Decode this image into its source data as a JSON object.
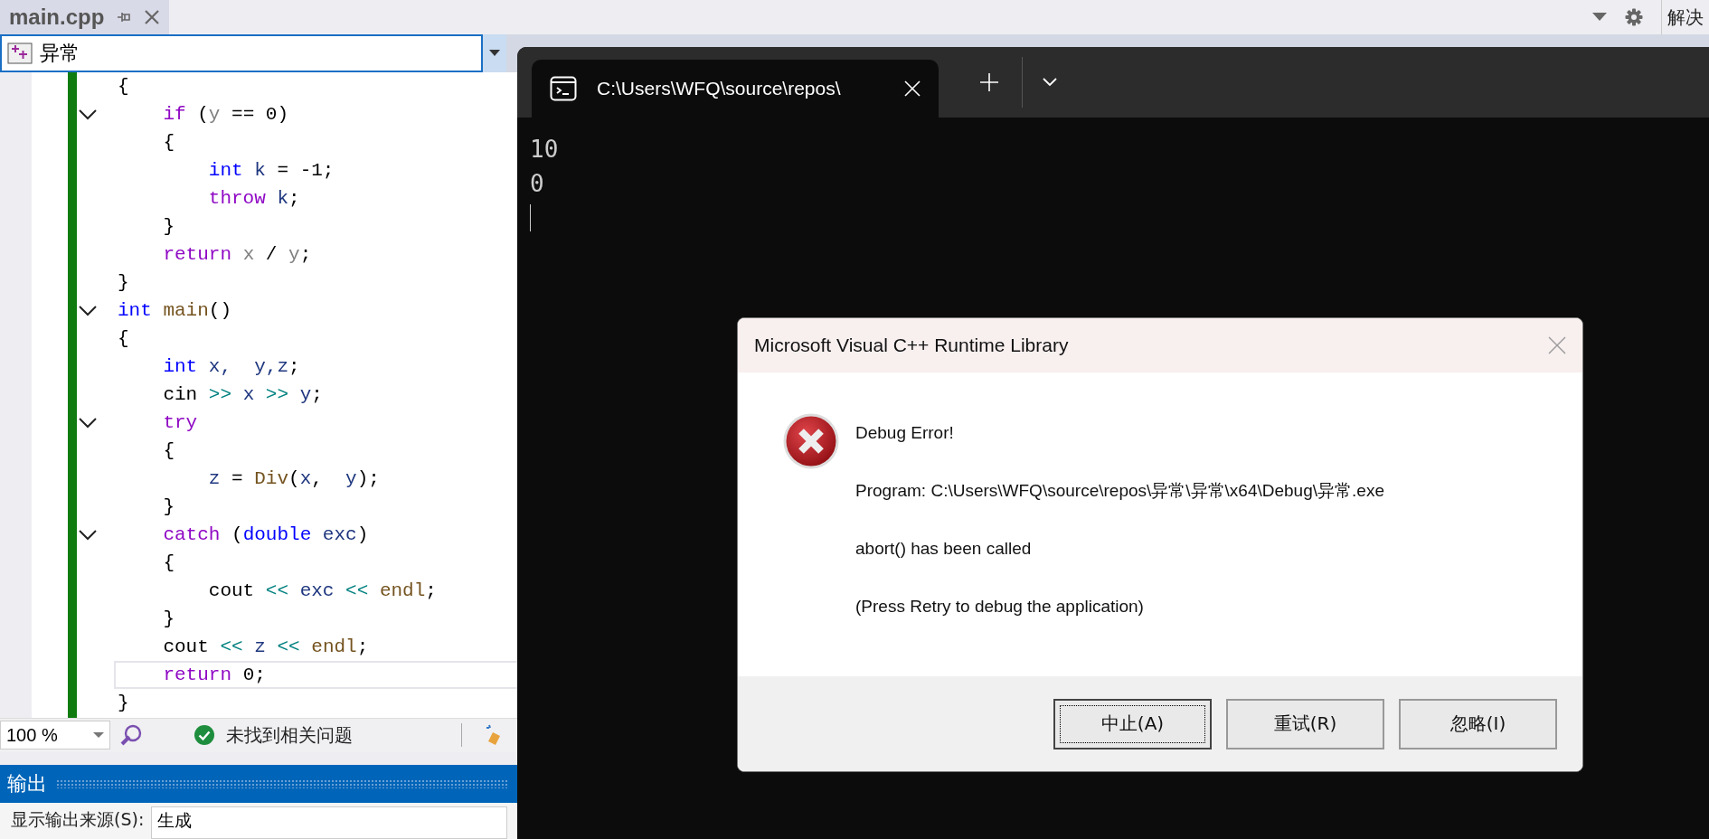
{
  "ide": {
    "doc_tab": {
      "title": "main.cpp",
      "selected": true
    },
    "nav": {
      "value": "异常"
    },
    "side_title": "解决",
    "code_lines": [
      {
        "fold": false,
        "current": false,
        "tokens": [
          {
            "text": "{",
            "kind": "plain"
          }
        ]
      },
      {
        "fold": true,
        "current": false,
        "tokens": [
          {
            "text": "    if",
            "kind": "keyword"
          },
          {
            "text": " (",
            "kind": "plain"
          },
          {
            "text": "y",
            "kind": "param"
          },
          {
            "text": " == 0)",
            "kind": "plain"
          }
        ]
      },
      {
        "fold": false,
        "current": false,
        "tokens": [
          {
            "text": "    {",
            "kind": "plain"
          }
        ]
      },
      {
        "fold": false,
        "current": false,
        "tokens": [
          {
            "text": "        int",
            "kind": "type"
          },
          {
            "text": " k",
            "kind": "local"
          },
          {
            "text": " = -1;",
            "kind": "plain"
          }
        ]
      },
      {
        "fold": false,
        "current": false,
        "tokens": [
          {
            "text": "        throw",
            "kind": "keyword"
          },
          {
            "text": " k",
            "kind": "local"
          },
          {
            "text": ";",
            "kind": "plain"
          }
        ]
      },
      {
        "fold": false,
        "current": false,
        "tokens": [
          {
            "text": "    }",
            "kind": "plain"
          }
        ]
      },
      {
        "fold": false,
        "current": false,
        "tokens": [
          {
            "text": "    return",
            "kind": "keyword"
          },
          {
            "text": " x",
            "kind": "param"
          },
          {
            "text": " / ",
            "kind": "plain"
          },
          {
            "text": "y",
            "kind": "param"
          },
          {
            "text": ";",
            "kind": "plain"
          }
        ]
      },
      {
        "fold": false,
        "current": false,
        "tokens": [
          {
            "text": "}",
            "kind": "plain"
          }
        ]
      },
      {
        "fold": true,
        "current": false,
        "tokens": [
          {
            "text": "int",
            "kind": "type"
          },
          {
            "text": " main",
            "kind": "func"
          },
          {
            "text": "()",
            "kind": "plain"
          }
        ]
      },
      {
        "fold": false,
        "current": false,
        "tokens": [
          {
            "text": "{",
            "kind": "plain"
          }
        ]
      },
      {
        "fold": false,
        "current": false,
        "tokens": [
          {
            "text": "    int",
            "kind": "type"
          },
          {
            "text": " x,  y,z",
            "kind": "local"
          },
          {
            "text": ";",
            "kind": "plain"
          }
        ]
      },
      {
        "fold": false,
        "current": false,
        "tokens": [
          {
            "text": "    cin",
            "kind": "plain"
          },
          {
            "text": " >>",
            "kind": "op"
          },
          {
            "text": " x",
            "kind": "local"
          },
          {
            "text": " >>",
            "kind": "op"
          },
          {
            "text": " y",
            "kind": "local"
          },
          {
            "text": ";",
            "kind": "plain"
          }
        ]
      },
      {
        "fold": true,
        "current": false,
        "tokens": [
          {
            "text": "    try",
            "kind": "keyword"
          }
        ]
      },
      {
        "fold": false,
        "current": false,
        "tokens": [
          {
            "text": "    {",
            "kind": "plain"
          }
        ]
      },
      {
        "fold": false,
        "current": false,
        "tokens": [
          {
            "text": "        z",
            "kind": "local"
          },
          {
            "text": " = ",
            "kind": "plain"
          },
          {
            "text": "Div",
            "kind": "func"
          },
          {
            "text": "(",
            "kind": "plain"
          },
          {
            "text": "x",
            "kind": "local"
          },
          {
            "text": ",  ",
            "kind": "plain"
          },
          {
            "text": "y",
            "kind": "local"
          },
          {
            "text": ");",
            "kind": "plain"
          }
        ]
      },
      {
        "fold": false,
        "current": false,
        "tokens": [
          {
            "text": "    }",
            "kind": "plain"
          }
        ]
      },
      {
        "fold": true,
        "current": false,
        "tokens": [
          {
            "text": "    catch",
            "kind": "keyword"
          },
          {
            "text": " (",
            "kind": "plain"
          },
          {
            "text": "double",
            "kind": "type"
          },
          {
            "text": " exc",
            "kind": "local"
          },
          {
            "text": ")",
            "kind": "plain"
          }
        ]
      },
      {
        "fold": false,
        "current": false,
        "tokens": [
          {
            "text": "    {",
            "kind": "plain"
          }
        ]
      },
      {
        "fold": false,
        "current": false,
        "tokens": [
          {
            "text": "        cout",
            "kind": "plain"
          },
          {
            "text": " <<",
            "kind": "op"
          },
          {
            "text": " exc",
            "kind": "local"
          },
          {
            "text": " <<",
            "kind": "op"
          },
          {
            "text": " endl",
            "kind": "func"
          },
          {
            "text": ";",
            "kind": "plain"
          }
        ]
      },
      {
        "fold": false,
        "current": false,
        "tokens": [
          {
            "text": "    }",
            "kind": "plain"
          }
        ]
      },
      {
        "fold": false,
        "current": false,
        "tokens": [
          {
            "text": "    cout",
            "kind": "plain"
          },
          {
            "text": " <<",
            "kind": "op"
          },
          {
            "text": " z",
            "kind": "local"
          },
          {
            "text": " <<",
            "kind": "op"
          },
          {
            "text": " endl",
            "kind": "func"
          },
          {
            "text": ";",
            "kind": "plain"
          }
        ]
      },
      {
        "fold": false,
        "current": true,
        "tokens": [
          {
            "text": "    return",
            "kind": "keyword"
          },
          {
            "text": " 0;",
            "kind": "plain"
          }
        ]
      },
      {
        "fold": false,
        "current": false,
        "tokens": [
          {
            "text": "}",
            "kind": "plain"
          }
        ]
      }
    ],
    "status": {
      "zoom": "100 %",
      "message": "未找到相关问题"
    },
    "output": {
      "title": "输出",
      "source_label": "显示输出来源(S):",
      "source_value": "生成"
    }
  },
  "terminal": {
    "tab_title": "C:\\Users\\WFQ\\source\\repos\\",
    "lines": [
      "10",
      "0"
    ]
  },
  "dialog": {
    "title": "Microsoft Visual C++ Runtime Library",
    "messages": [
      "Debug Error!",
      "Program: C:\\Users\\WFQ\\source\\repos\\异常\\异常\\x64\\Debug\\异常.exe",
      "abort() has been called",
      "(Press Retry to debug the application)"
    ],
    "buttons": [
      {
        "label": "中止(A)",
        "focused": true
      },
      {
        "label": "重试(R)",
        "focused": false
      },
      {
        "label": "忽略(I)",
        "focused": false
      }
    ]
  }
}
